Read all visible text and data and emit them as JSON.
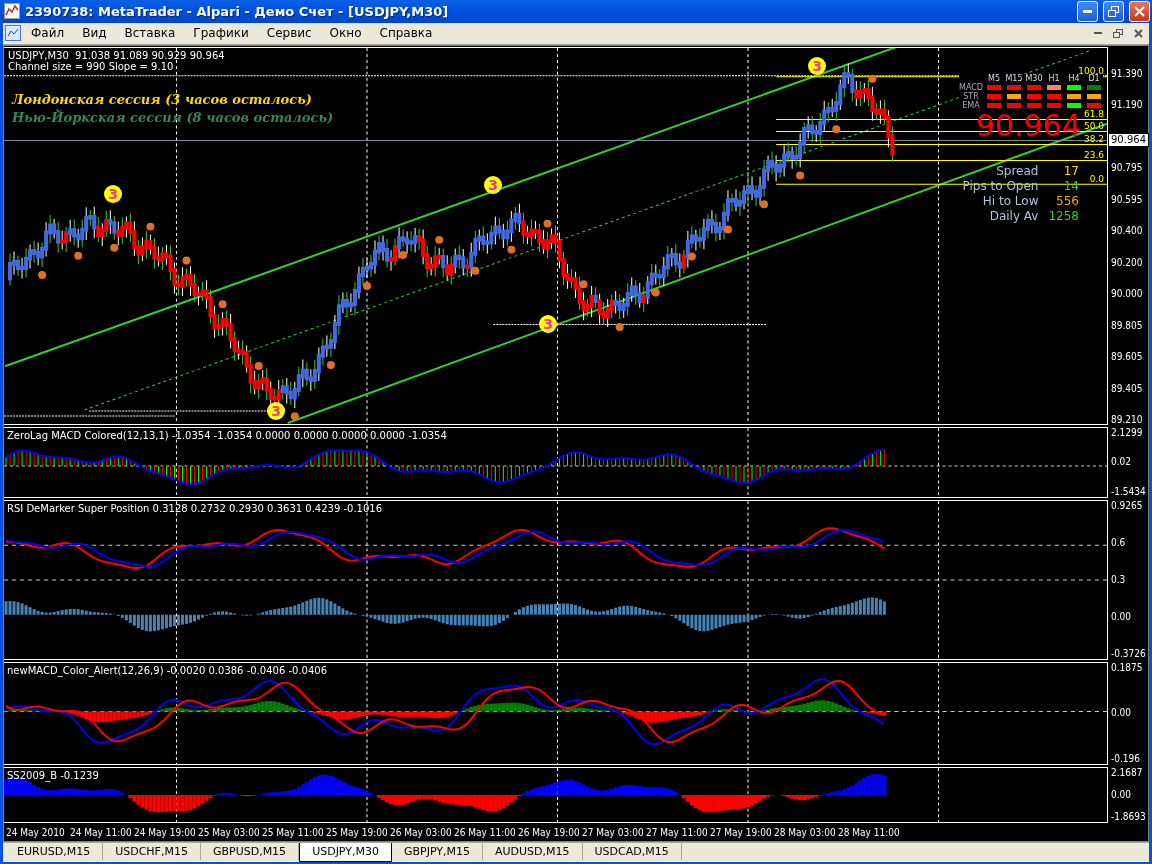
{
  "window": {
    "title": "2390738: MetaTrader - Alpari - Демо Счет - [USDJPY,M30]"
  },
  "menu": [
    "Файл",
    "Вид",
    "Вставка",
    "Графики",
    "Сервис",
    "Окно",
    "Справка"
  ],
  "chart": {
    "header": [
      "USDJPY,M30  91.038 91.089 90.929 90.964",
      "Channel size = 990 Slope = 9.10"
    ],
    "sessions": [
      {
        "text": "Лондонская сессия (3 часов осталось)",
        "color": "#ffd700"
      },
      {
        "text": "Нью-Йоркская сессия (8 часов осталось)",
        "color": "#2e8b57"
      }
    ],
    "wave_markers": [
      "3",
      "3",
      "3",
      "3",
      "3"
    ],
    "fib_levels": [
      "100.0",
      "61.8",
      "50.0",
      "38.2",
      "23.6",
      "0.0"
    ],
    "signals": {
      "timeframes": [
        "M5",
        "M15",
        "M30",
        "H1",
        "H4",
        "D1"
      ],
      "rows": [
        {
          "label": "MACD",
          "cells": [
            {
              "color": "#ff0000"
            },
            {
              "color": "#ff0000"
            },
            {
              "color": "#ff0000"
            },
            {
              "color": "#fa8072"
            },
            {
              "color": "#00ff00"
            },
            {
              "color": "#008000"
            }
          ]
        },
        {
          "label": "STR",
          "cells": [
            {
              "color": "#ff0000"
            },
            {
              "color": "#ffa500"
            },
            {
              "color": "#ff0000"
            },
            {
              "color": "#ff0000"
            },
            {
              "color": "#ffa500"
            },
            {
              "color": "#ffa500"
            }
          ]
        },
        {
          "label": "EMA",
          "cells": [
            {
              "color": "#ff0000"
            },
            {
              "color": "#ff0000"
            },
            {
              "color": "#ff0000"
            },
            {
              "color": "#ff0000"
            },
            {
              "color": "#00ff00"
            },
            {
              "color": "#ff0000"
            }
          ]
        }
      ]
    },
    "big_price": "90.964",
    "stats": [
      {
        "label": "Spread",
        "value": "17",
        "color": "#ffd700"
      },
      {
        "label": "Pips to Open",
        "value": "14",
        "color": "#32cd32"
      },
      {
        "label": "Hi to Low",
        "value": "556",
        "color": "#ffa500"
      },
      {
        "label": "Daily Av",
        "value": "1258",
        "color": "#32cd32"
      }
    ],
    "price_axis": [
      "91.390",
      "91.190",
      "90.795",
      "90.595",
      "90.400",
      "90.200",
      "90.000",
      "89.805",
      "89.605",
      "89.405",
      "89.210"
    ],
    "current_price": "90.964"
  },
  "indicators": [
    {
      "kind": "zerolag",
      "title": "ZeroLag MACD Colored(12,13,1) -1.0354 -1.0354 0.0000 0.0000 0.0000 0.0000 -1.0354",
      "axis": [
        "2.1299",
        "0.02",
        "-1.5434"
      ]
    },
    {
      "kind": "rsi",
      "title": "RSI DeMarker Super Position 0.3128 0.2732 0.2930 0.3631 0.4239 -0.1016",
      "axis": [
        "0.9265",
        "0.6",
        "0.3",
        "0.00",
        "-0.3726"
      ]
    },
    {
      "kind": "newmacd",
      "title": "newMACD_Color_Alert(12,26,9) -0.0020 0.0386 -0.0406 -0.0406",
      "axis": [
        "0.1875",
        "0.00",
        "-0.196"
      ]
    },
    {
      "kind": "ss",
      "title": "SS2009_B -0.1239",
      "axis": [
        "2.1687",
        "0.00",
        "-1.8693"
      ]
    }
  ],
  "time_axis": [
    "24 May 2010",
    "24 May 11:00",
    "24 May 19:00",
    "25 May 03:00",
    "25 May 11:00",
    "25 May 19:00",
    "26 May 03:00",
    "26 May 11:00",
    "26 May 19:00",
    "27 May 03:00",
    "27 May 11:00",
    "27 May 19:00",
    "28 May 03:00",
    "28 May 11:00"
  ],
  "tabs": [
    {
      "label": "EURUSD,M15",
      "selected": false
    },
    {
      "label": "USDCHF,M15",
      "selected": false
    },
    {
      "label": "GBPUSD,M15",
      "selected": false
    },
    {
      "label": "USDJPY,M30",
      "selected": true
    },
    {
      "label": "GBPJPY,M15",
      "selected": false
    },
    {
      "label": "AUDUSD,M15",
      "selected": false
    },
    {
      "label": "USDCAD,M15",
      "selected": false
    }
  ]
}
